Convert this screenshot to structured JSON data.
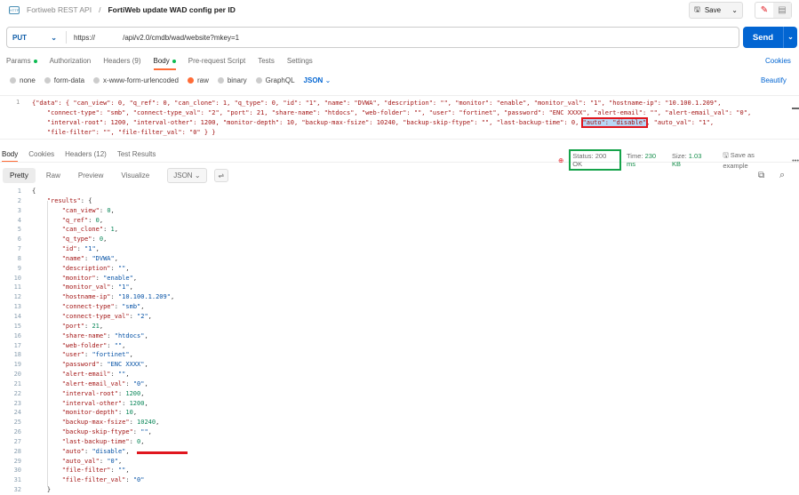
{
  "breadcrumb": {
    "collection": "Fortiweb REST API",
    "separator": "/",
    "request": "FortiWeb update WAD config per ID"
  },
  "toolbar": {
    "save": "Save"
  },
  "request": {
    "method": "PUT",
    "url": "https://              /api/v2.0/cmdb/wad/website?mkey=1",
    "send": "Send"
  },
  "tabs": [
    "Params",
    "Authorization",
    "Headers (9)",
    "Body",
    "Pre-request Script",
    "Tests",
    "Settings"
  ],
  "cookies": "Cookies",
  "body_types": [
    "none",
    "form-data",
    "x-www-form-urlencoded",
    "raw",
    "binary",
    "GraphQL"
  ],
  "body_format": "JSON",
  "beautify": "Beautify",
  "request_body": {
    "line_number": "1",
    "line1": "{\"data\": { \"can_view\": 0, \"q_ref\": 0, \"can_clone\": 1, \"q_type\": 0, \"id\": \"1\", \"name\": \"DVWA\", \"description\": \"\", \"monitor\": \"enable\", \"monitor_val\": \"1\", \"hostname-ip\": \"10.100.1.209\",",
    "line2": "    \"connect-type\": \"smb\", \"connect-type_val\": \"2\", \"port\": 21, \"share-name\": \"htdocs\", \"web-folder\": \"\", \"user\": \"fortinet\", \"password\": \"ENC XXXX\", \"alert-email\": \"\", \"alert-email_val\": \"0\",",
    "line3_pre": "    \"interval-root\": 1200, \"interval-other\": 1200, \"monitor-depth\": 10, \"backup-max-fsize\": 10240, \"backup-skip-ftype\": \"\", \"last-backup-time\": 0, ",
    "line3_highlight": "\"auto\": \"disable\"",
    "line3_post": ", \"auto_val\": \"1\",",
    "line4": "    \"file-filter\": \"\", \"file-filter_val\": \"0\" } }"
  },
  "response_tabs": [
    "Body",
    "Cookies",
    "Headers (12)",
    "Test Results"
  ],
  "status": {
    "status": "Status: 200 OK",
    "time_label": "Time:",
    "time": "230 ms",
    "size_label": "Size:",
    "size": "1.03 KB",
    "save_example": "Save as example"
  },
  "view_modes": [
    "Pretty",
    "Raw",
    "Preview",
    "Visualize"
  ],
  "response_format": "JSON",
  "response_lines": [
    {
      "n": "1",
      "t": [
        [
          "p",
          "{"
        ]
      ]
    },
    {
      "n": "2",
      "t": [
        [
          "p",
          "    "
        ],
        [
          "k",
          "\"results\""
        ],
        [
          "p",
          ": {"
        ]
      ]
    },
    {
      "n": "3",
      "t": [
        [
          "p",
          "        "
        ],
        [
          "k",
          "\"can_view\""
        ],
        [
          "p",
          ": "
        ],
        [
          "num",
          "0"
        ],
        [
          "p",
          ","
        ]
      ]
    },
    {
      "n": "4",
      "t": [
        [
          "p",
          "        "
        ],
        [
          "k",
          "\"q_ref\""
        ],
        [
          "p",
          ": "
        ],
        [
          "num",
          "0"
        ],
        [
          "p",
          ","
        ]
      ]
    },
    {
      "n": "5",
      "t": [
        [
          "p",
          "        "
        ],
        [
          "k",
          "\"can_clone\""
        ],
        [
          "p",
          ": "
        ],
        [
          "num",
          "1"
        ],
        [
          "p",
          ","
        ]
      ]
    },
    {
      "n": "6",
      "t": [
        [
          "p",
          "        "
        ],
        [
          "k",
          "\"q_type\""
        ],
        [
          "p",
          ": "
        ],
        [
          "num",
          "0"
        ],
        [
          "p",
          ","
        ]
      ]
    },
    {
      "n": "7",
      "t": [
        [
          "p",
          "        "
        ],
        [
          "k",
          "\"id\""
        ],
        [
          "p",
          ": "
        ],
        [
          "s",
          "\"1\""
        ],
        [
          "p",
          ","
        ]
      ]
    },
    {
      "n": "8",
      "t": [
        [
          "p",
          "        "
        ],
        [
          "k",
          "\"name\""
        ],
        [
          "p",
          ": "
        ],
        [
          "s",
          "\"DVWA\""
        ],
        [
          "p",
          ","
        ]
      ]
    },
    {
      "n": "9",
      "t": [
        [
          "p",
          "        "
        ],
        [
          "k",
          "\"description\""
        ],
        [
          "p",
          ": "
        ],
        [
          "s",
          "\"\""
        ],
        [
          "p",
          ","
        ]
      ]
    },
    {
      "n": "10",
      "t": [
        [
          "p",
          "        "
        ],
        [
          "k",
          "\"monitor\""
        ],
        [
          "p",
          ": "
        ],
        [
          "s",
          "\"enable\""
        ],
        [
          "p",
          ","
        ]
      ]
    },
    {
      "n": "11",
      "t": [
        [
          "p",
          "        "
        ],
        [
          "k",
          "\"monitor_val\""
        ],
        [
          "p",
          ": "
        ],
        [
          "s",
          "\"1\""
        ],
        [
          "p",
          ","
        ]
      ]
    },
    {
      "n": "12",
      "t": [
        [
          "p",
          "        "
        ],
        [
          "k",
          "\"hostname-ip\""
        ],
        [
          "p",
          ": "
        ],
        [
          "s",
          "\"10.100.1.209\""
        ],
        [
          "p",
          ","
        ]
      ]
    },
    {
      "n": "13",
      "t": [
        [
          "p",
          "        "
        ],
        [
          "k",
          "\"connect-type\""
        ],
        [
          "p",
          ": "
        ],
        [
          "s",
          "\"smb\""
        ],
        [
          "p",
          ","
        ]
      ]
    },
    {
      "n": "14",
      "t": [
        [
          "p",
          "        "
        ],
        [
          "k",
          "\"connect-type_val\""
        ],
        [
          "p",
          ": "
        ],
        [
          "s",
          "\"2\""
        ],
        [
          "p",
          ","
        ]
      ]
    },
    {
      "n": "15",
      "t": [
        [
          "p",
          "        "
        ],
        [
          "k",
          "\"port\""
        ],
        [
          "p",
          ": "
        ],
        [
          "num",
          "21"
        ],
        [
          "p",
          ","
        ]
      ]
    },
    {
      "n": "16",
      "t": [
        [
          "p",
          "        "
        ],
        [
          "k",
          "\"share-name\""
        ],
        [
          "p",
          ": "
        ],
        [
          "s",
          "\"htdocs\""
        ],
        [
          "p",
          ","
        ]
      ]
    },
    {
      "n": "17",
      "t": [
        [
          "p",
          "        "
        ],
        [
          "k",
          "\"web-folder\""
        ],
        [
          "p",
          ": "
        ],
        [
          "s",
          "\"\""
        ],
        [
          "p",
          ","
        ]
      ]
    },
    {
      "n": "18",
      "t": [
        [
          "p",
          "        "
        ],
        [
          "k",
          "\"user\""
        ],
        [
          "p",
          ": "
        ],
        [
          "s",
          "\"fortinet\""
        ],
        [
          "p",
          ","
        ]
      ]
    },
    {
      "n": "19",
      "t": [
        [
          "p",
          "        "
        ],
        [
          "k",
          "\"password\""
        ],
        [
          "p",
          ": "
        ],
        [
          "s",
          "\"ENC XXXX\""
        ],
        [
          "p",
          ","
        ]
      ]
    },
    {
      "n": "20",
      "t": [
        [
          "p",
          "        "
        ],
        [
          "k",
          "\"alert-email\""
        ],
        [
          "p",
          ": "
        ],
        [
          "s",
          "\"\""
        ],
        [
          "p",
          ","
        ]
      ]
    },
    {
      "n": "21",
      "t": [
        [
          "p",
          "        "
        ],
        [
          "k",
          "\"alert-email_val\""
        ],
        [
          "p",
          ": "
        ],
        [
          "s",
          "\"0\""
        ],
        [
          "p",
          ","
        ]
      ]
    },
    {
      "n": "22",
      "t": [
        [
          "p",
          "        "
        ],
        [
          "k",
          "\"interval-root\""
        ],
        [
          "p",
          ": "
        ],
        [
          "num",
          "1200"
        ],
        [
          "p",
          ","
        ]
      ]
    },
    {
      "n": "23",
      "t": [
        [
          "p",
          "        "
        ],
        [
          "k",
          "\"interval-other\""
        ],
        [
          "p",
          ": "
        ],
        [
          "num",
          "1200"
        ],
        [
          "p",
          ","
        ]
      ]
    },
    {
      "n": "24",
      "t": [
        [
          "p",
          "        "
        ],
        [
          "k",
          "\"monitor-depth\""
        ],
        [
          "p",
          ": "
        ],
        [
          "num",
          "10"
        ],
        [
          "p",
          ","
        ]
      ]
    },
    {
      "n": "25",
      "t": [
        [
          "p",
          "        "
        ],
        [
          "k",
          "\"backup-max-fsize\""
        ],
        [
          "p",
          ": "
        ],
        [
          "num",
          "10240"
        ],
        [
          "p",
          ","
        ]
      ]
    },
    {
      "n": "26",
      "t": [
        [
          "p",
          "        "
        ],
        [
          "k",
          "\"backup-skip-ftype\""
        ],
        [
          "p",
          ": "
        ],
        [
          "s",
          "\"\""
        ],
        [
          "p",
          ","
        ]
      ]
    },
    {
      "n": "27",
      "t": [
        [
          "p",
          "        "
        ],
        [
          "k",
          "\"last-backup-time\""
        ],
        [
          "p",
          ": "
        ],
        [
          "num",
          "0"
        ],
        [
          "p",
          ","
        ]
      ]
    },
    {
      "n": "28",
      "t": [
        [
          "p",
          "        "
        ],
        [
          "k",
          "\"auto\""
        ],
        [
          "p",
          ": "
        ],
        [
          "s",
          "\"disable\""
        ],
        [
          "p",
          ","
        ]
      ]
    },
    {
      "n": "29",
      "t": [
        [
          "p",
          "        "
        ],
        [
          "k",
          "\"auto_val\""
        ],
        [
          "p",
          ": "
        ],
        [
          "s",
          "\"0\""
        ],
        [
          "p",
          ","
        ]
      ]
    },
    {
      "n": "30",
      "t": [
        [
          "p",
          "        "
        ],
        [
          "k",
          "\"file-filter\""
        ],
        [
          "p",
          ": "
        ],
        [
          "s",
          "\"\""
        ],
        [
          "p",
          ","
        ]
      ]
    },
    {
      "n": "31",
      "t": [
        [
          "p",
          "        "
        ],
        [
          "k",
          "\"file-filter_val\""
        ],
        [
          "p",
          ": "
        ],
        [
          "s",
          "\"0\""
        ]
      ]
    },
    {
      "n": "32",
      "t": [
        [
          "p",
          "    }"
        ]
      ]
    }
  ]
}
